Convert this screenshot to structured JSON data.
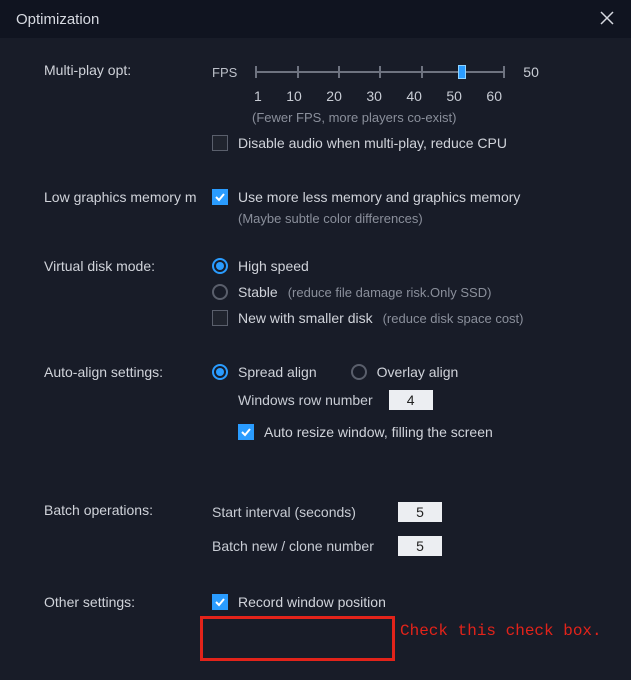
{
  "window": {
    "title": "Optimization"
  },
  "multi": {
    "label": "Multi-play opt:",
    "unit": "FPS",
    "ticks": [
      "1",
      "10",
      "20",
      "30",
      "40",
      "50",
      "60"
    ],
    "value": 50,
    "display_value": "50",
    "hint": "(Fewer FPS, more players co-exist)",
    "disable_audio_checked": false,
    "disable_audio_label": "Disable audio when multi-play, reduce CPU"
  },
  "lowgfx": {
    "label": "Low graphics memory m",
    "checked": true,
    "cb_label": "Use more less memory and graphics memory",
    "hint": "(Maybe subtle color differences)"
  },
  "vdisk": {
    "label": "Virtual disk mode:",
    "selected": "high",
    "high_label": "High speed",
    "stable_label": "Stable",
    "stable_hint": "(reduce file damage risk.Only SSD)",
    "new_checked": false,
    "new_label": "New with smaller disk",
    "new_hint": "(reduce disk space cost)"
  },
  "align": {
    "label": "Auto-align settings:",
    "selected": "spread",
    "spread_label": "Spread align",
    "overlay_label": "Overlay align",
    "rownum_label": "Windows row number",
    "rownum_value": "4",
    "autoresize_checked": true,
    "autoresize_label": "Auto resize window, filling the screen"
  },
  "batch": {
    "label": "Batch operations:",
    "start_label": "Start interval (seconds)",
    "start_value": "5",
    "clone_label": "Batch new / clone number",
    "clone_value": "5"
  },
  "other": {
    "label": "Other settings:",
    "record_checked": true,
    "record_label": "Record window position"
  },
  "annotation": {
    "text": "Check this check box."
  }
}
